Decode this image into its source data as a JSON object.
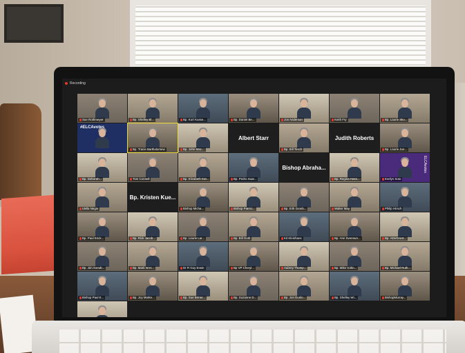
{
  "screen": {
    "recording_label": "Recording",
    "participants": [
      {
        "name": "Sue Rothmeyer"
      },
      {
        "name": "Bp. Shelley Bl..."
      },
      {
        "name": "Bp. Kurt Kusse..."
      },
      {
        "name": "Bp. Daniel Be..."
      },
      {
        "name": "Jon Anderson"
      },
      {
        "name": "Keith Fry"
      },
      {
        "name": "Bp. Laurie Sko..."
      },
      {
        "name": "",
        "hashtag": "#ELCAvotes"
      },
      {
        "name": "Bp. Tracie Bartholomew",
        "active": true
      },
      {
        "name": "Bp. John Mac..."
      },
      {
        "big_name": "Albert Starr"
      },
      {
        "name": "Bp. Bill Tesch"
      },
      {
        "big_name": "Judith Roberts"
      },
      {
        "name": "Bp. Laurie Jun..."
      },
      {
        "name": "Bp. Deborah..."
      },
      {
        "name": "Tom Connell"
      },
      {
        "name": "Bp. Elizabeth Eat..."
      },
      {
        "name": "Bp. Pedro Suar..."
      },
      {
        "big_name": "Bishop Abraha..."
      },
      {
        "name": "Bp. Regina Hass..."
      },
      {
        "name": "Evelyn Soto",
        "vertical": "ELCAvotes"
      },
      {
        "name": "Idella Negin"
      },
      {
        "name": "Bp. Kristen Kue...",
        "big_name": "Bp. Kristen Kue..."
      },
      {
        "name": "Bishop Micha..."
      },
      {
        "name": "Bishop Patrici..."
      },
      {
        "name": "Bp. Erik Gronb..."
      },
      {
        "name": "Walter May"
      },
      {
        "name": "Philip Hirsch"
      },
      {
        "name": "Bp. Paul Erick..."
      },
      {
        "name": "Bp. Rick Jacob..."
      },
      {
        "name": "Bp. Laurie Lar..."
      },
      {
        "name": "Bp. Bill Gohl"
      },
      {
        "name": "Kit Kleinhans"
      },
      {
        "name": "Bp. Ann Svennun..."
      },
      {
        "name": "Bp. ADeGroot..."
      },
      {
        "name": "Bp. Jim Arendt..."
      },
      {
        "name": "Bp. Mark W.H..."
      },
      {
        "name": "Dr R Guy Erwin"
      },
      {
        "name": "Bp VP Cheryl..."
      },
      {
        "name": "Aubrey Thomp..."
      },
      {
        "name": "Bp. Mike Girlin..."
      },
      {
        "name": "Bp. Michael Ruth..."
      },
      {
        "name": "Bishop Paul E..."
      },
      {
        "name": "Bp. Joy Morke..."
      },
      {
        "name": "Bp. Sue Briner..."
      },
      {
        "name": "Bp. Suzanne D..."
      },
      {
        "name": "Bp. Jon Dunlo..."
      },
      {
        "name": "Bp. Shelley Wi..."
      },
      {
        "name": "BishopMurray..."
      },
      {
        "name": "Deacon John..."
      }
    ]
  }
}
